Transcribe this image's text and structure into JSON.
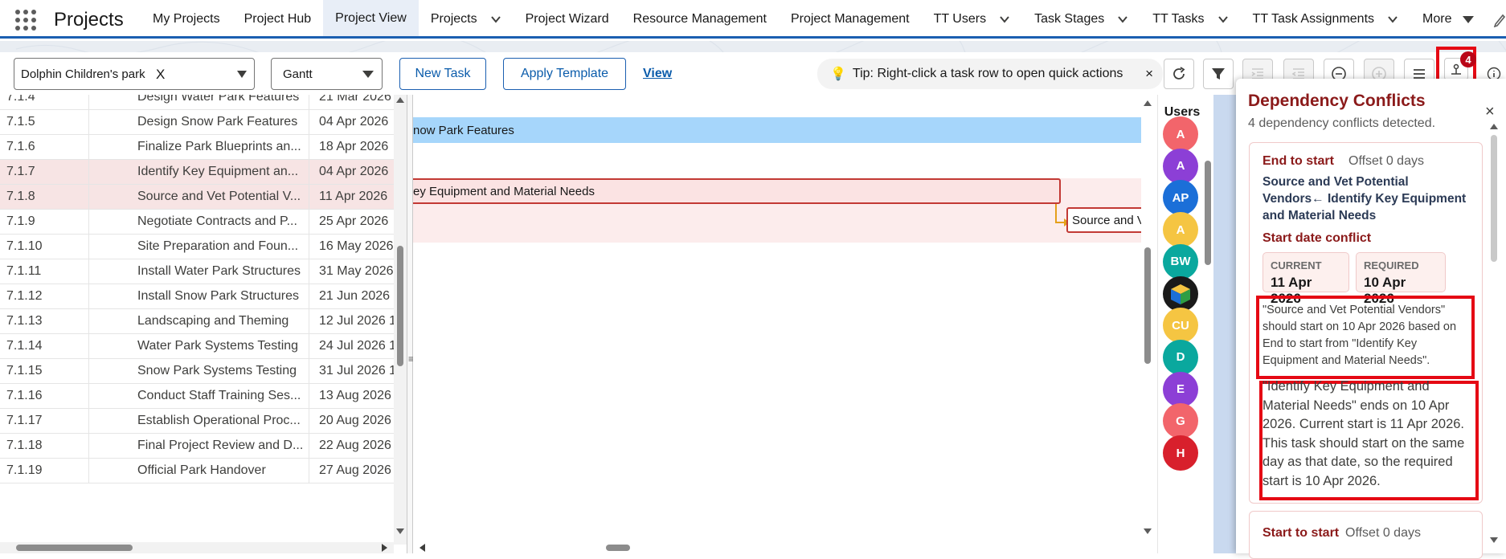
{
  "app": {
    "name": "Projects"
  },
  "nav": {
    "items": [
      {
        "label": "My Projects",
        "dropdown": false,
        "active": false
      },
      {
        "label": "Project Hub",
        "dropdown": false,
        "active": false
      },
      {
        "label": "Project View",
        "dropdown": false,
        "active": true
      },
      {
        "label": "Projects",
        "dropdown": true,
        "active": false
      },
      {
        "label": "Project Wizard",
        "dropdown": false,
        "active": false
      },
      {
        "label": "Resource Management",
        "dropdown": false,
        "active": false
      },
      {
        "label": "Project Management",
        "dropdown": false,
        "active": false
      },
      {
        "label": "TT Users",
        "dropdown": true,
        "active": false
      },
      {
        "label": "Task Stages",
        "dropdown": true,
        "active": false
      },
      {
        "label": "TT Tasks",
        "dropdown": true,
        "active": false
      },
      {
        "label": "TT Task Assignments",
        "dropdown": true,
        "active": false
      }
    ],
    "more": "More"
  },
  "toolbar": {
    "project": "Dolphin Children's park",
    "clear": "X",
    "view_mode": "Gantt",
    "new_task": "New Task",
    "apply_template": "Apply Template",
    "view_link": "View",
    "tip": "Tip: Right-click a task row to open quick actions",
    "tip_close": "×",
    "conflict_count": "4"
  },
  "tasks": [
    {
      "wbs": "7.1.4",
      "name": "Design Water Park Features",
      "date": "21 Mar 2026",
      "hl": false
    },
    {
      "wbs": "7.1.5",
      "name": "Design Snow Park Features",
      "date": "04 Apr 2026",
      "hl": false
    },
    {
      "wbs": "7.1.6",
      "name": "Finalize Park Blueprints an...",
      "date": "18 Apr 2026",
      "hl": false
    },
    {
      "wbs": "7.1.7",
      "name": "Identify Key Equipment an...",
      "date": "04 Apr 2026",
      "hl": true
    },
    {
      "wbs": "7.1.8",
      "name": "Source and Vet Potential V...",
      "date": "11 Apr 2026",
      "hl": true
    },
    {
      "wbs": "7.1.9",
      "name": "Negotiate Contracts and P...",
      "date": "25 Apr 2026",
      "hl": false
    },
    {
      "wbs": "7.1.10",
      "name": "Site Preparation and Foun...",
      "date": "16 May 2026",
      "hl": false
    },
    {
      "wbs": "7.1.11",
      "name": "Install Water Park Structures",
      "date": "31 May 2026",
      "hl": false
    },
    {
      "wbs": "7.1.12",
      "name": "Install Snow Park Structures",
      "date": "21 Jun 2026",
      "hl": false
    },
    {
      "wbs": "7.1.13",
      "name": "Landscaping and Theming",
      "date": "12 Jul 2026 1",
      "hl": false
    },
    {
      "wbs": "7.1.14",
      "name": "Water Park Systems Testing",
      "date": "24 Jul 2026 1",
      "hl": false
    },
    {
      "wbs": "7.1.15",
      "name": "Snow Park Systems Testing",
      "date": "31 Jul 2026 1",
      "hl": false
    },
    {
      "wbs": "7.1.16",
      "name": "Conduct Staff Training Ses...",
      "date": "13 Aug 2026",
      "hl": false
    },
    {
      "wbs": "7.1.17",
      "name": "Establish Operational Proc...",
      "date": "20 Aug 2026",
      "hl": false
    },
    {
      "wbs": "7.1.18",
      "name": "Final Project Review and D...",
      "date": "22 Aug 2026",
      "hl": false
    },
    {
      "wbs": "7.1.19",
      "name": "Official Park Handover",
      "date": "27 Aug 2026",
      "hl": false
    }
  ],
  "gantt": {
    "snow_bar": "now Park Features",
    "identify_bar": "ey Equipment and Material Needs",
    "source_bar": "Source and Ve"
  },
  "users": {
    "header": "Users",
    "avatars": [
      {
        "initials": "A",
        "color": "#f2656b"
      },
      {
        "initials": "A",
        "color": "#8c3fd6"
      },
      {
        "initials": "AP",
        "color": "#1b6fd8"
      },
      {
        "initials": "A",
        "color": "#f5c542"
      },
      {
        "initials": "BW",
        "color": "#0aa89e"
      },
      {
        "initials": "",
        "color": "#1a1a1a"
      },
      {
        "initials": "CU",
        "color": "#f5c542"
      },
      {
        "initials": "D",
        "color": "#0aa89e"
      },
      {
        "initials": "E",
        "color": "#8c3fd6"
      },
      {
        "initials": "G",
        "color": "#f2656b"
      },
      {
        "initials": "H",
        "color": "#d8202c"
      }
    ]
  },
  "panel": {
    "title": "Dependency Conflicts",
    "subtitle": "4 dependency conflicts detected.",
    "close": "×",
    "card1": {
      "type": "End to start",
      "offset": "Offset 0 days",
      "pair": "Source and Vet Potential Vendors← Identify Key Equipment and Material Needs",
      "conflict": "Start date conflict",
      "current_label": "CURRENT",
      "current_value": "11 Apr 2026",
      "required_label": "REQUIRED",
      "required_value": "10 Apr 2026",
      "message1": "\"Source and Vet Potential Vendors\" should start on 10 Apr 2026 based on End to start from \"Identify Key Equipment and Material Needs\".",
      "message2": "\"Identify Key Equipment and Material Needs\" ends on 10 Apr 2026. Current start is 11 Apr 2026. This task should start on the same day as that date, so the required start is 10 Apr 2026."
    },
    "card2": {
      "type": "Start to start",
      "offset": "Offset 0 days"
    }
  }
}
